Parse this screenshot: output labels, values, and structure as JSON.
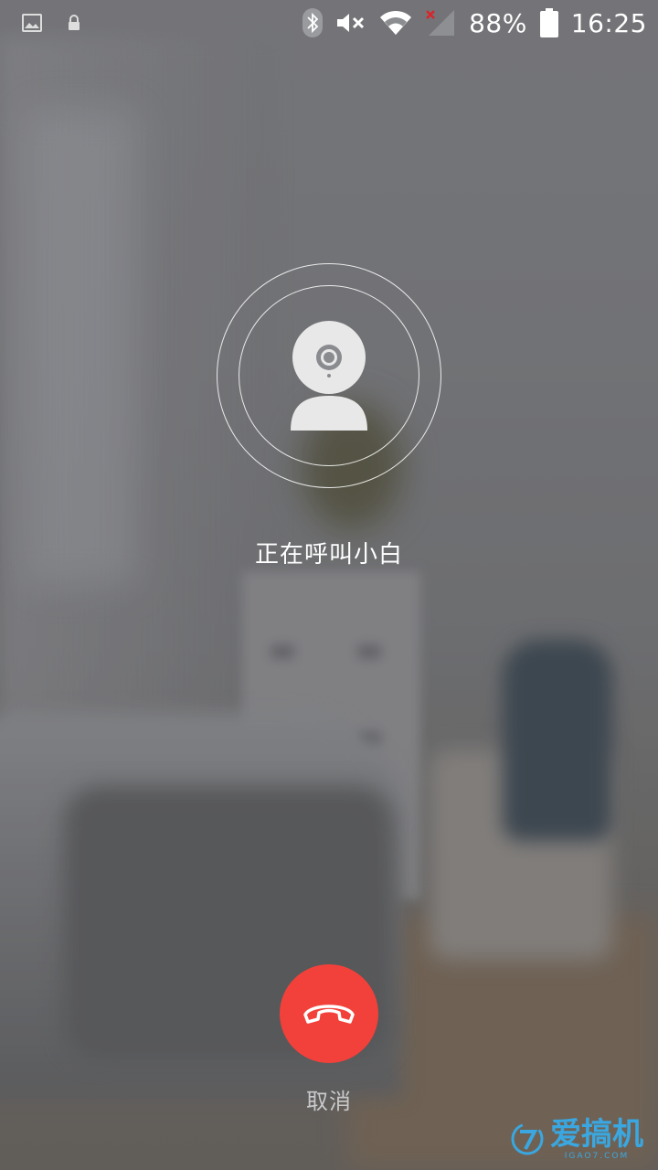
{
  "status_bar": {
    "battery_text": "88%",
    "time": "16:25",
    "icons": [
      "image-notification-icon",
      "lock-icon",
      "bluetooth-icon",
      "mute-icon",
      "wifi-icon",
      "no-signal-icon",
      "battery-icon"
    ]
  },
  "call": {
    "status_text": "正在呼叫小白",
    "avatar_icon": "camera-icon"
  },
  "actions": {
    "hangup_label": "取消",
    "hangup_color": "#f2413a"
  },
  "watermark": {
    "badge": "7",
    "text": "爱搞机",
    "sub": "IGAO7.COM",
    "color": "#3aa7e0"
  }
}
